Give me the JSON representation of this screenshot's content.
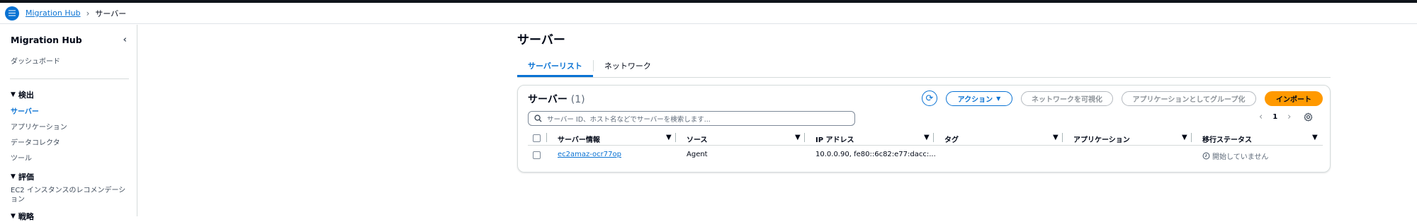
{
  "breadcrumb": {
    "home": "Migration Hub",
    "current": "サーバー"
  },
  "sidebar": {
    "title": "Migration Hub",
    "dashboard": "ダッシュボード",
    "sections": {
      "discover": {
        "label": "検出",
        "items": [
          "サーバー",
          "アプリケーション",
          "データコレクタ",
          "ツール"
        ]
      },
      "assess": {
        "label": "評価",
        "items": [
          "EC2 インスタンスのレコメンデーション"
        ]
      },
      "strategy": {
        "label": "戦略"
      }
    }
  },
  "page": {
    "title": "サーバー",
    "tabs": [
      "サーバーリスト",
      "ネットワーク"
    ]
  },
  "panel": {
    "title": "サーバー",
    "count": "(1)",
    "buttons": {
      "action": "アクション",
      "visualize_network": "ネットワークを可視化",
      "group_as_app": "アプリケーションとしてグループ化",
      "import": "インポート"
    },
    "search_placeholder": "サーバー ID、ホスト名などでサーバーを検索します...",
    "page_number": "1"
  },
  "table": {
    "columns": [
      "サーバー情報",
      "ソース",
      "IP アドレス",
      "タグ",
      "アプリケーション",
      "移行ステータス"
    ],
    "rows": [
      {
        "server": "ec2amaz-ocr77op",
        "source": "Agent",
        "ip": "10.0.0.90, fe80::6c82:e77:dacc:...",
        "tag": "",
        "application": "",
        "status": "開始していません"
      }
    ]
  },
  "colors": {
    "accent": "#0972d3",
    "import": "#ff9900"
  }
}
